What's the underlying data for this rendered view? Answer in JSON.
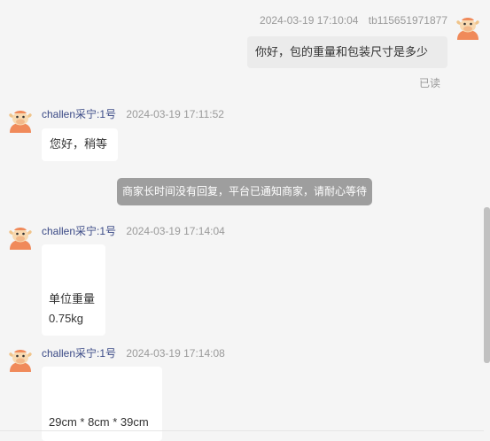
{
  "conversation": {
    "outgoing": {
      "time": "2024-03-19 17:10:04",
      "sender": "tb115651971877",
      "text": "你好，包的重量和包装尺寸是多少",
      "status": "已读"
    },
    "replies": [
      {
        "sender": "challen采宁:1号",
        "time": "2024-03-19 17:11:52",
        "lines": [
          "您好，稍等"
        ]
      },
      {
        "sender": "challen采宁:1号",
        "time": "2024-03-19 17:14:04",
        "lines": [
          "单位重量",
          "0.75kg"
        ]
      },
      {
        "sender": "challen采宁:1号",
        "time": "2024-03-19 17:14:08",
        "lines": [
          "29cm * 8cm * 39cm"
        ]
      }
    ],
    "system_notice": "商家长时间没有回复，平台已通知商家，请耐心等待"
  },
  "icons": {
    "avatar": "cow-avatar-icon"
  },
  "colors": {
    "sender_name": "#3b4a86",
    "notice_bg": "#9e9e9e",
    "avatar_orange": "#f08a5a"
  }
}
